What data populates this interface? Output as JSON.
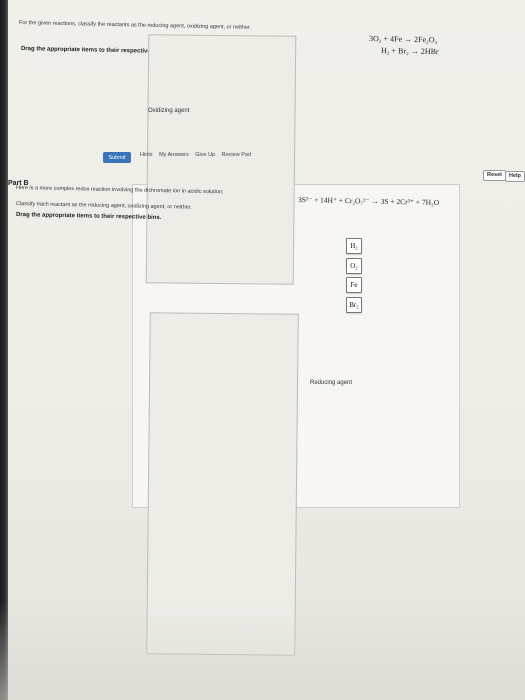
{
  "part_a": {
    "instruction": "For the given reactions, classify the reactants as the reducing agent, oxidizing agent, or neither.",
    "equation_1": "3O₂ + 4Fe → 2Fe₂O₃",
    "equation_2": "H₂ + Br₂ → 2HBr",
    "drag_instruction": "Drag the appropriate items to their respective bins.",
    "reset_label": "Reset",
    "help_label": "Help",
    "tiles": [
      "H₂",
      "O₂",
      "Fe",
      "Br₂"
    ],
    "bins": {
      "oxidizing_label": "Oxidizing agent",
      "reducing_label": "Reducing agent"
    },
    "submit_label": "Submit",
    "links": [
      "Hints",
      "My Answers",
      "Give Up",
      "Review Part"
    ]
  },
  "part_b": {
    "title": "Part B",
    "intro": "Here is a more complex redox reaction involving the dichromate ion in acidic solution:",
    "reaction": "3S²⁻ + 14H⁺ + Cr₂O₇²⁻ → 3S + 2Cr³⁺ + 7H₂O",
    "classify_instruction": "Classify each reactant as the reducing agent, oxidizing agent, or neither.",
    "drag_instruction": "Drag the appropriate items to their respective bins."
  }
}
